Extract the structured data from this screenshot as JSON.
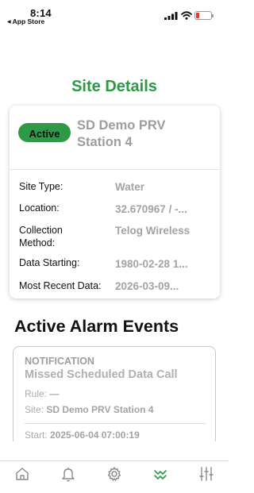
{
  "status_bar": {
    "time": "8:14",
    "back_label": "App Store",
    "back_icon": "triangle-left-icon",
    "battery_color": "#e23b2e"
  },
  "page": {
    "title": "Site Details",
    "title_color": "#2a9a43"
  },
  "site": {
    "status": "Active",
    "status_color": "#2e9a47",
    "name": "SD Demo PRV Station 4",
    "details": [
      {
        "label": "Site Type:",
        "value": "Water"
      },
      {
        "label": "Location:",
        "value": "32.670967 / -..."
      },
      {
        "label": "Collection Method:",
        "value": "Telog Wireless"
      },
      {
        "label": "Data Starting:",
        "value": "1980-02-28 1..."
      },
      {
        "label": "Most Recent Data:",
        "value": "2026-03-09..."
      }
    ]
  },
  "alarms": {
    "heading": "Active Alarm Events",
    "events": [
      {
        "type": "NOTIFICATION",
        "title": "Missed Scheduled Data Call",
        "rule_label": "Rule:",
        "rule_value": "—",
        "site_label": "Site:",
        "site_value": "SD Demo PRV Station 4",
        "start_label": "Start:",
        "start_value": "2025-06-04 07:00:19"
      }
    ]
  },
  "tabs": [
    {
      "name": "home",
      "icon": "home-icon",
      "active": false
    },
    {
      "name": "alarms",
      "icon": "bell-icon",
      "active": false
    },
    {
      "name": "settings",
      "icon": "gear-icon",
      "active": false
    },
    {
      "name": "trends",
      "icon": "wave-chevron-icon",
      "active": true
    },
    {
      "name": "filters",
      "icon": "sliders-icon",
      "active": false
    }
  ],
  "colors": {
    "tab_active": "#2a9a43",
    "tab_inactive": "#8a8a8a"
  }
}
